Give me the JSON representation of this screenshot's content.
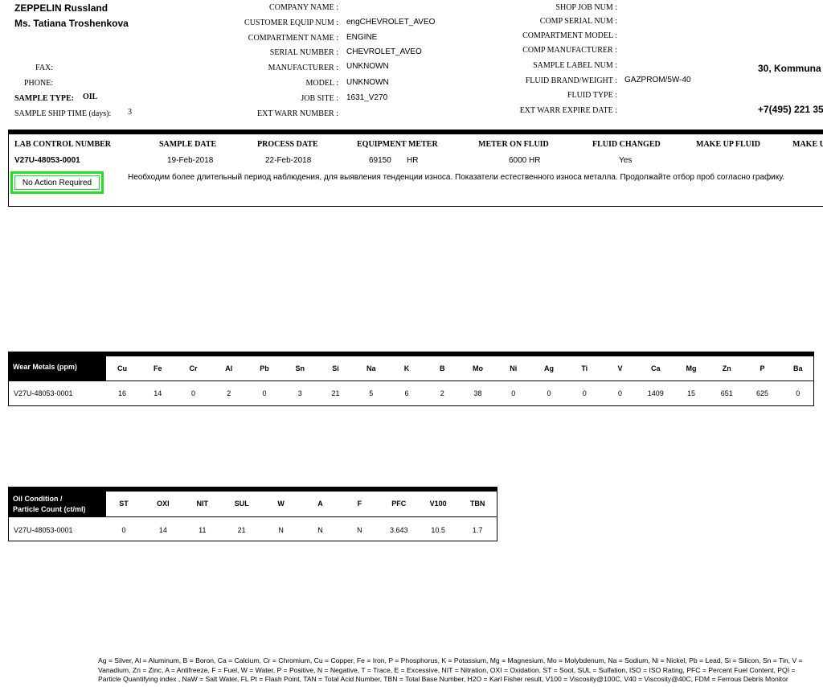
{
  "customer": {
    "company": "ZEPPELIN Russland",
    "contact": "Ms. Tatiana Troshenkova",
    "fax_label": "FAX:",
    "phone_label": "PHONE:",
    "sample_type_label": "SAMPLE TYPE:",
    "sample_type": "OIL",
    "ship_time_label": "SAMPLE SHIP TIME  (days):",
    "ship_time": "3",
    "address_fragment": "30, Kommuna",
    "phone_fragment": "+7(495) 221 35"
  },
  "equipment": {
    "company_name_label": "COMPANY NAME :",
    "customer_equip_label": "CUSTOMER EQUIP NUM :",
    "customer_equip": "engCHEVROLET_AVEO",
    "compartment_label": "COMPARTMENT NAME :",
    "compartment": "ENGINE",
    "serial_label": "SERIAL NUMBER :",
    "serial": "CHEVROLET_AVEO",
    "manufacturer_label": "MANUFACTURER :",
    "manufacturer": "UNKNOWN",
    "model_label": "MODEL :",
    "model": "UNKNOWN",
    "job_site_label": "JOB SITE :",
    "job_site": "1631_V270",
    "ext_warr_label": "EXT WARR NUMBER :"
  },
  "shop": {
    "shop_job_label": "SHOP JOB NUM :",
    "comp_serial_label": "COMP SERIAL NUM :",
    "comp_model_label": "COMPARTMENT MODEL :",
    "comp_manufacturer_label": "COMP MANUFACTURER :",
    "sample_label_label": "SAMPLE LABEL NUM :",
    "fluid_brand_label": "FLUID BRAND/WEIGHT :",
    "fluid_brand": "GAZPROM/5W-40",
    "fluid_type_label": "FLUID TYPE :",
    "ext_warr_expire_label": "EXT WARR EXPIRE DATE :"
  },
  "sample": {
    "headers": [
      "LAB CONTROL NUMBER",
      "SAMPLE  DATE",
      "PROCESS DATE",
      "EQUIPMENT METER",
      "METER ON FLUID",
      "FLUID CHANGED",
      "MAKE UP FLUID",
      "MAKE U"
    ],
    "lab_control": "V27U-48053-0001",
    "sample_date": "19-Feb-2018",
    "process_date": "22-Feb-2018",
    "equipment_meter": "69150",
    "meter_unit": "HR",
    "meter_on_fluid": "6000 HR",
    "fluid_changed": "Yes",
    "status": "No Action Required",
    "comment": "Необходим более длительный период наблюдения, для выявления тенденции износа.  Показатели естественного износа металла.  Продолжайте отбор проб согласно графику."
  },
  "wear_metals": {
    "title": "Wear Metals (ppm)",
    "row_label": "V27U-48053-0001",
    "columns": [
      "Cu",
      "Fe",
      "Cr",
      "Al",
      "Pb",
      "Sn",
      "Si",
      "Na",
      "K",
      "B",
      "Mo",
      "Ni",
      "Ag",
      "Ti",
      "V",
      "Ca",
      "Mg",
      "Zn",
      "P",
      "Ba"
    ],
    "values": [
      "16",
      "14",
      "0",
      "2",
      "0",
      "3",
      "21",
      "5",
      "6",
      "2",
      "38",
      "0",
      "0",
      "0",
      "0",
      "1409",
      "15",
      "651",
      "625",
      "0"
    ]
  },
  "oil_condition": {
    "title_line1": "Oil Condition /",
    "title_line2": "Particle Count (ct/ml)",
    "row_label": "V27U-48053-0001",
    "columns": [
      "ST",
      "OXI",
      "NIT",
      "SUL",
      "W",
      "A",
      "F",
      "PFC",
      "V100",
      "TBN"
    ],
    "values": [
      "0",
      "14",
      "11",
      "21",
      "N",
      "N",
      "N",
      "3.643",
      "10.5",
      "1.7"
    ]
  },
  "legend": "Ag = Silver, Al = Aluminum, B = Boron, Ca = Calcium, Cr = Chromium, Cu = Copper, Fe = Iron, P = Phosphorus, K = Potassium, Mg = Magnesium,  Mo = Molybdenum, Na = Sodium, Ni = Nickel, Pb = Lead, Si = Silicon, Sn = Tin, V = Vanadium, Zn = Zinc, A = Antifreeze, F = Fuel, W = Water,  P = Positive, N = Negative, T = Trace, E = Excessive, NIT = Nitration, OXI = Oxidation, ST = Soot, SUL = Sulfation, ISO = ISO Rating, PFC = Percent Fuel Content, PQI = Particle Quantifying index , NaW = Salt Water, FL Pt = Flash Point, TAN = Total Acid Number, TBN = Total Base Number, H2O = Karl Fisher result, V100 = Viscosity@100C, V40 = Viscosity@40C, FDM = Ferrous Debris Monitor"
}
